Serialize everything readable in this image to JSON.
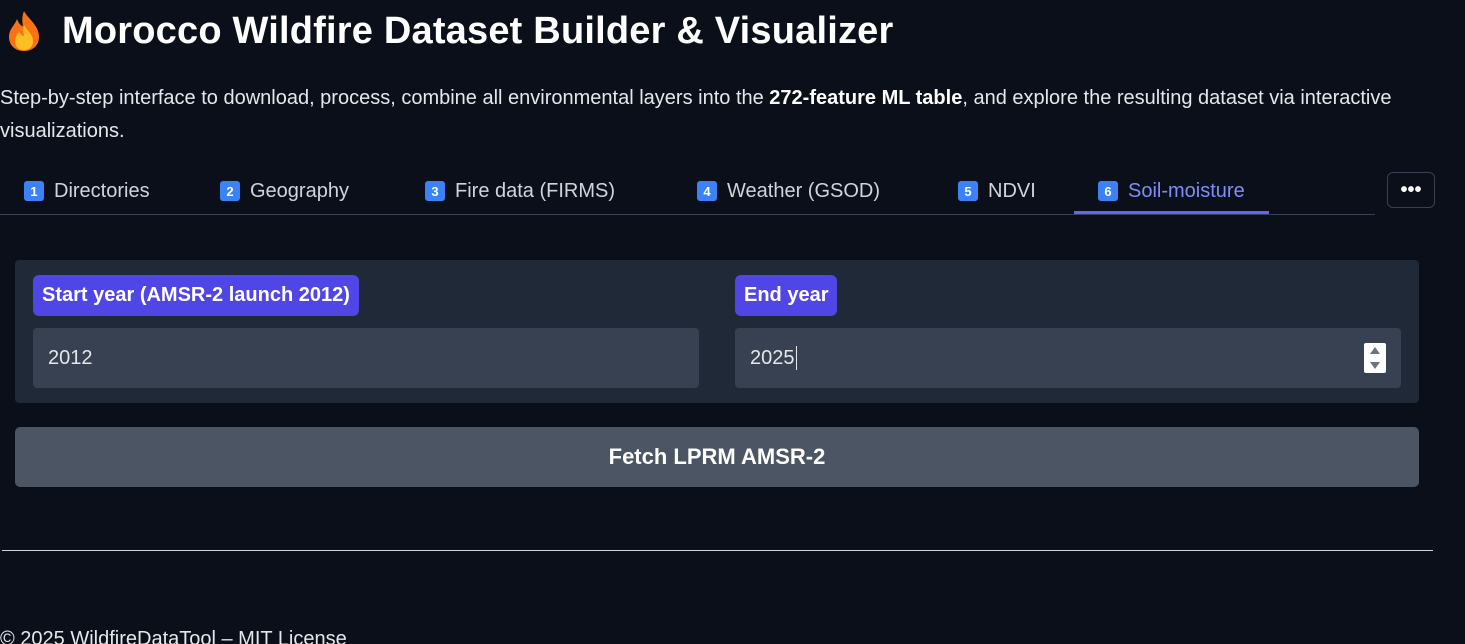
{
  "header": {
    "title": "Morocco Wildfire Dataset Builder & Visualizer",
    "icon": "fire-icon",
    "description_pre": "Step-by-step interface to download, process, combine all environmental layers into the ",
    "description_bold": "272-feature ML table",
    "description_post": ", and explore the resulting dataset via interactive visualizations."
  },
  "tabs": [
    {
      "num": "1",
      "label": "Directories",
      "active": false
    },
    {
      "num": "2",
      "label": "Geography",
      "active": false
    },
    {
      "num": "3",
      "label": "Fire data (FIRMS)",
      "active": false
    },
    {
      "num": "4",
      "label": "Weather (GSOD)",
      "active": false
    },
    {
      "num": "5",
      "label": "NDVI",
      "active": false
    },
    {
      "num": "6",
      "label": "Soil-moisture",
      "active": true
    }
  ],
  "more_button": {
    "label": "•••",
    "icon": "more-horizontal-icon"
  },
  "form": {
    "start_year": {
      "label": "Start year (AMSR-2 launch 2012)",
      "value": "2012"
    },
    "end_year": {
      "label": "End year",
      "value": "2025"
    }
  },
  "fetch_button": {
    "label": "Fetch LPRM AMSR-2"
  },
  "footer": {
    "text": "© 2025 WildfireDataTool – MIT License"
  },
  "colors": {
    "background": "#0b0f19",
    "accent": "#4f46e5",
    "active_tab": "#818cf8",
    "panel": "#1f2937",
    "input": "#374151",
    "button": "#4b5563"
  }
}
